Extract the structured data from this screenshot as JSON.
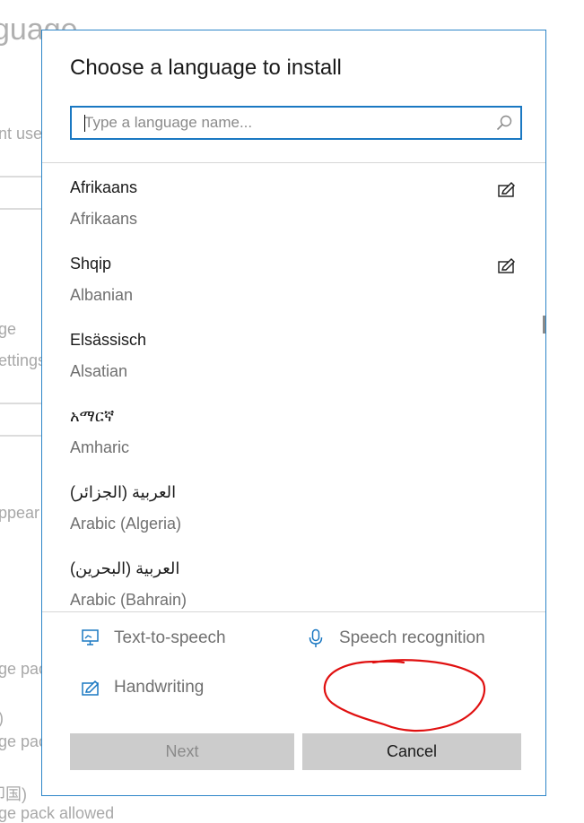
{
  "background": {
    "title_fragment": "guage",
    "fragments": [
      "nt use",
      "ge",
      "ettings",
      "ppear",
      "ge pac",
      ")",
      "ge pac",
      "印国)",
      "ge pack allowed"
    ]
  },
  "dialog": {
    "title": "Choose a language to install",
    "search": {
      "placeholder": "Type a language name...",
      "value": ""
    },
    "languages": [
      {
        "native": "Afrikaans",
        "english": "Afrikaans",
        "features": [
          "handwriting-icon"
        ]
      },
      {
        "native": "Shqip",
        "english": "Albanian",
        "features": [
          "handwriting-icon"
        ]
      },
      {
        "native": "Elsässisch",
        "english": "Alsatian",
        "features": []
      },
      {
        "native": "አማርኛ",
        "english": "Amharic",
        "features": []
      },
      {
        "native": "العربية (الجزائر)",
        "english": "Arabic (Algeria)",
        "features": []
      },
      {
        "native": "العربية (البحرين)",
        "english": "Arabic (Bahrain)",
        "features": []
      }
    ],
    "legend": {
      "text_to_speech": "Text-to-speech",
      "speech_recognition": "Speech recognition",
      "handwriting": "Handwriting"
    },
    "buttons": {
      "next": "Next",
      "cancel": "Cancel"
    }
  },
  "colors": {
    "accent": "#1a78c2",
    "dialog_border": "#2e86c8",
    "button_bg": "#cccccc",
    "annotation_red": "#e01010"
  }
}
